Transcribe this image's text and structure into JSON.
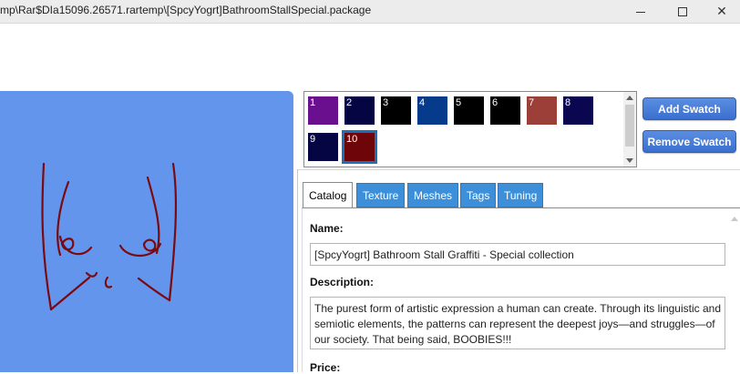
{
  "window": {
    "title": "mp\\Rar$DIa15096.26571.rartemp\\[SpcyYogrt]BathroomStallSpecial.package",
    "close_glyph": "✕"
  },
  "swatches": [
    {
      "label": "1",
      "color": "#6a0f8e"
    },
    {
      "label": "2",
      "color": "#050544"
    },
    {
      "label": "3",
      "color": "#000000"
    },
    {
      "label": "4",
      "color": "#063a8a"
    },
    {
      "label": "5",
      "color": "#000000"
    },
    {
      "label": "6",
      "color": "#000000"
    },
    {
      "label": "7",
      "color": "#9c3f38"
    },
    {
      "label": "8",
      "color": "#0a0650"
    },
    {
      "label": "9",
      "color": "#050544"
    },
    {
      "label": "10",
      "color": "#6e0508",
      "selected": true
    }
  ],
  "buttons": {
    "add_swatch": "Add Swatch",
    "remove_swatch": "Remove Swatch"
  },
  "tabs": [
    {
      "label": "Catalog",
      "active": true
    },
    {
      "label": "Texture"
    },
    {
      "label": "Meshes"
    },
    {
      "label": "Tags"
    },
    {
      "label": "Tuning"
    }
  ],
  "catalog": {
    "name_label": "Name:",
    "name_value": "[SpcyYogrt] Bathroom Stall Graffiti - Special collection",
    "description_label": "Description:",
    "description_value": "The purest form of artistic expression a human can create. Through its linguistic and semiotic elements, the patterns can represent the deepest joys—and struggles—of our society. That being said, BOOBIES!!!",
    "price_label": "Price:"
  },
  "colors": {
    "preview_bg": "#6495ed",
    "accent": "#3c8fd8",
    "sketch_stroke": "#7a0a10"
  }
}
